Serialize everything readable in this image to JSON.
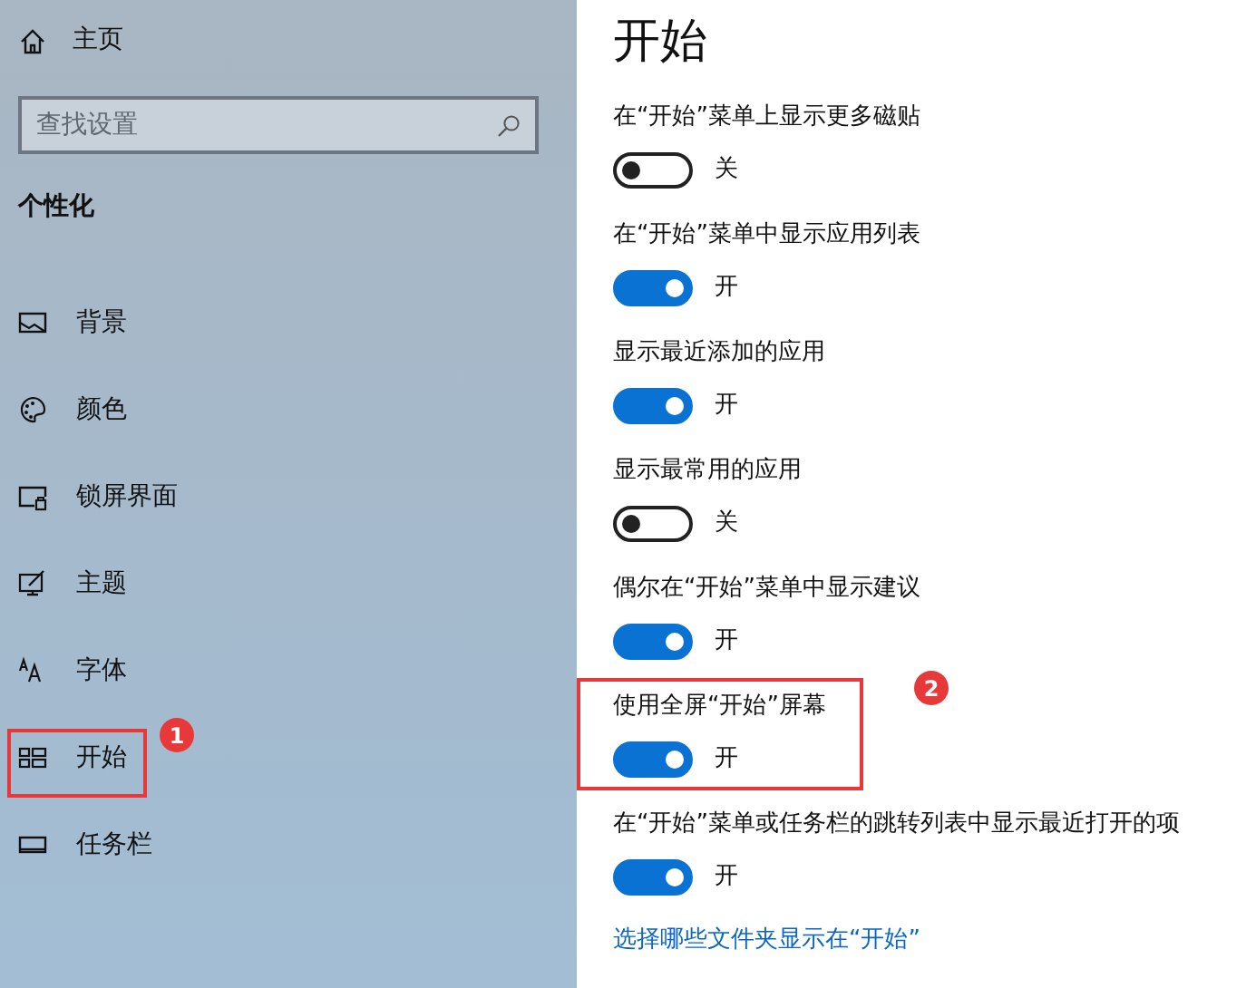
{
  "sidebar": {
    "home": "主页",
    "search": {
      "placeholder": "查找设置"
    },
    "section": "个性化",
    "items": [
      {
        "label": "背景"
      },
      {
        "label": "颜色"
      },
      {
        "label": "锁屏界面"
      },
      {
        "label": "主题"
      },
      {
        "label": "字体"
      },
      {
        "label": "开始",
        "callout": "1"
      },
      {
        "label": "任务栏"
      }
    ]
  },
  "page": {
    "title": "开始",
    "settings": [
      {
        "label": "在“开始”菜单上显示更多磁贴",
        "on": false,
        "state_text": "关"
      },
      {
        "label": "在“开始”菜单中显示应用列表",
        "on": true,
        "state_text": "开"
      },
      {
        "label": "显示最近添加的应用",
        "on": true,
        "state_text": "开"
      },
      {
        "label": "显示最常用的应用",
        "on": false,
        "state_text": "关"
      },
      {
        "label": "偶尔在“开始”菜单中显示建议",
        "on": true,
        "state_text": "开"
      },
      {
        "label": "使用全屏“开始”屏幕",
        "on": true,
        "state_text": "开",
        "callout": "2"
      },
      {
        "label": "在“开始”菜单或任务栏的跳转列表中显示最近打开的项",
        "on": true,
        "state_text": "开"
      }
    ],
    "link": "选择哪些文件夹显示在“开始”"
  }
}
